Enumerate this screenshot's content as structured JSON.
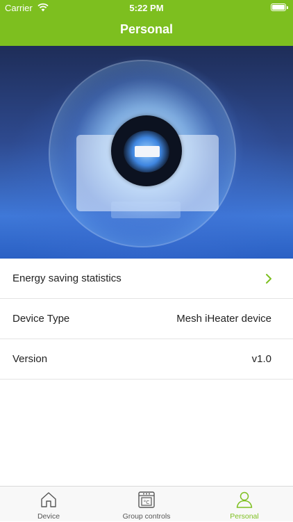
{
  "status_bar": {
    "carrier": "Carrier",
    "time": "5:22 PM"
  },
  "nav": {
    "title": "Personal"
  },
  "list": {
    "items": [
      {
        "label": "Energy saving statistics",
        "value": ""
      },
      {
        "label": "Device Type",
        "value": "Mesh iHeater device"
      },
      {
        "label": "Version",
        "value": "v1.0"
      }
    ]
  },
  "tabbar": {
    "tabs": [
      {
        "label": "Device",
        "icon": "house-icon",
        "active": false
      },
      {
        "label": "Group controls",
        "icon": "heater-panel-icon",
        "active": false
      },
      {
        "label": "Personal",
        "icon": "person-icon",
        "active": true
      }
    ]
  },
  "colors": {
    "accent": "#7dbf1f",
    "inactive": "#555555",
    "divider": "#e4e4e4"
  }
}
